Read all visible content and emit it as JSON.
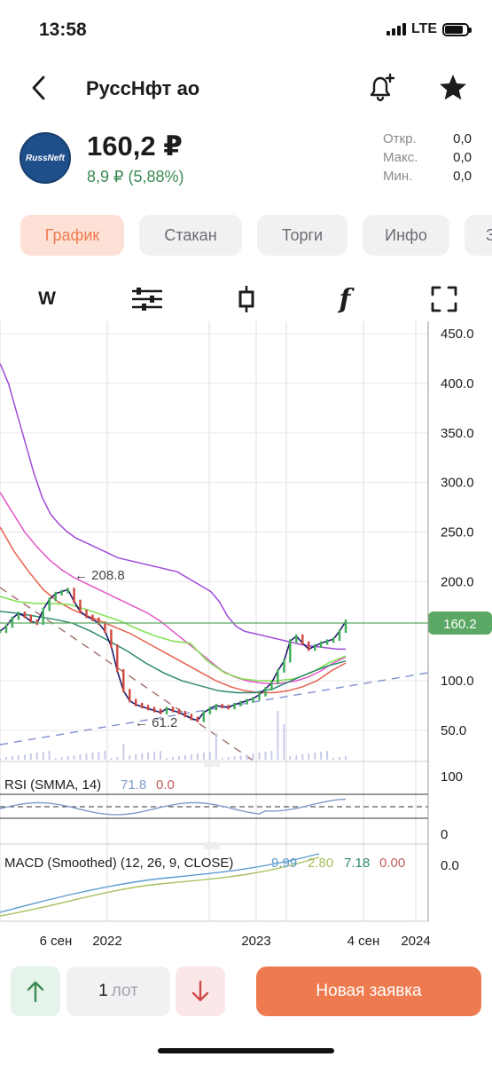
{
  "status_bar": {
    "time": "13:58",
    "network": "LTE"
  },
  "nav": {
    "title": "РуссНфт ао"
  },
  "instrument": {
    "logo_text": "RussNeft",
    "price": "160,2 ₽",
    "change": "8,9 ₽ (5,88%)",
    "stats": [
      {
        "label": "Откр.",
        "value": "0,0"
      },
      {
        "label": "Макс.",
        "value": "0,0"
      },
      {
        "label": "Мин.",
        "value": "0,0"
      }
    ]
  },
  "tabs": [
    {
      "label": "График",
      "active": true
    },
    {
      "label": "Стакан",
      "active": false
    },
    {
      "label": "Торги",
      "active": false
    },
    {
      "label": "Инфо",
      "active": false
    },
    {
      "label": "З",
      "active": false
    }
  ],
  "toolbar": {
    "interval_label": "W",
    "indicators_icon": "sliders-icon",
    "candle_icon": "candlestick-icon",
    "function_label": "f",
    "fullscreen_icon": "expand-icon"
  },
  "chart_data": {
    "type": "line",
    "title": "",
    "y_axis": {
      "ticks": [
        "450.0",
        "400.0",
        "350.0",
        "300.0",
        "250.0",
        "200.0",
        "100.0",
        "50.0"
      ],
      "ylim": [
        40,
        460
      ]
    },
    "x_axis": {
      "ticks": [
        "6 сен",
        "2022",
        "2023",
        "4 сен",
        "2024"
      ]
    },
    "current_price_label": "160.2",
    "annotations": [
      {
        "text": "← 208.8"
      },
      {
        "text": "← 61.2"
      }
    ],
    "series": [
      {
        "name": "price",
        "color": "#1e1a6e",
        "x": [
          0,
          1,
          2,
          3,
          4,
          5,
          6,
          7,
          8,
          9,
          10,
          11,
          12,
          13,
          14,
          15,
          16,
          17,
          18,
          19,
          20,
          21,
          22,
          23,
          24,
          25,
          26,
          27,
          28,
          29,
          30,
          31,
          32,
          33,
          34,
          35,
          36,
          37,
          38,
          39,
          40,
          41,
          42,
          43,
          44,
          45,
          46,
          47,
          48,
          49,
          50,
          51,
          52,
          53,
          54,
          55,
          56,
          57,
          58,
          59,
          60,
          61,
          62,
          63,
          64,
          65,
          66,
          67,
          68,
          69,
          70,
          71,
          72,
          73,
          74,
          75,
          76,
          77,
          78,
          79,
          80
        ],
        "values": [
          150,
          155,
          163,
          168,
          165,
          160,
          158,
          172,
          182,
          188,
          190,
          192,
          180,
          170,
          165,
          162,
          158,
          150,
          135,
          110,
          90,
          80,
          76,
          74,
          72,
          70,
          68,
          72,
          70,
          68,
          65,
          62,
          60,
          68,
          72,
          75,
          74,
          73,
          76,
          78,
          80,
          82,
          86,
          92,
          98,
          110,
          120,
          140,
          145,
          138,
          132,
          135,
          138,
          140,
          142,
          150,
          160,
          160,
          160,
          160,
          160,
          160,
          160,
          160,
          160,
          160,
          160,
          160,
          160,
          160,
          160,
          160,
          160,
          160,
          160,
          160,
          160,
          160,
          160,
          160,
          160
        ]
      },
      {
        "name": "SMA long",
        "color": "#a04ad9",
        "values": [
          420,
          400,
          370,
          340,
          310,
          285,
          268,
          258,
          250,
          244,
          240,
          236,
          232,
          228,
          224,
          222,
          220,
          218,
          216,
          214,
          212,
          210,
          205,
          200,
          195,
          190,
          180,
          165,
          155,
          150,
          148,
          146,
          144,
          142,
          140,
          138,
          136,
          135,
          134,
          133,
          132,
          132
        ]
      },
      {
        "name": "SMA mid",
        "color": "#e455c9",
        "values": [
          290,
          270,
          250,
          235,
          222,
          212,
          204,
          198,
          192,
          186,
          180,
          174,
          168,
          160,
          150,
          140,
          130,
          120,
          110,
          104,
          100,
          98,
          97,
          98,
          100,
          104,
          110,
          118,
          124
        ]
      },
      {
        "name": "EMA",
        "color": "#e65f4e",
        "values": [
          255,
          230,
          210,
          192,
          180,
          172,
          166,
          160,
          154,
          148,
          140,
          132,
          124,
          116,
          108,
          100,
          94,
          90,
          88,
          88,
          90,
          94,
          100,
          110,
          118
        ]
      },
      {
        "name": "SMA short",
        "color": "#7ee04c",
        "values": [
          185,
          180,
          178,
          178,
          177,
          172,
          166,
          160,
          152,
          145,
          140,
          138,
          120,
          108,
          102,
          100,
          100,
          102,
          108,
          118,
          125
        ]
      },
      {
        "name": "SMA teal",
        "color": "#2e8a6f",
        "values": [
          170,
          168,
          165,
          162,
          158,
          150,
          140,
          130,
          118,
          108,
          100,
          95,
          90,
          88,
          88,
          92,
          100,
          108,
          115,
          120
        ]
      }
    ],
    "rsi": {
      "label": "RSI (SMMA, 14)",
      "value1": "71.8",
      "value2": "0.0",
      "ticks": [
        "100",
        "0"
      ]
    },
    "macd": {
      "label": "MACD (Smoothed) (12, 26, 9, CLOSE)",
      "value1": "9.99",
      "value2": "2.80",
      "value3": "7.18",
      "value4": "0.00",
      "tick": "0.0"
    }
  },
  "bottom": {
    "qty": "1",
    "qty_unit": "лот",
    "order_label": "Новая заявка"
  }
}
